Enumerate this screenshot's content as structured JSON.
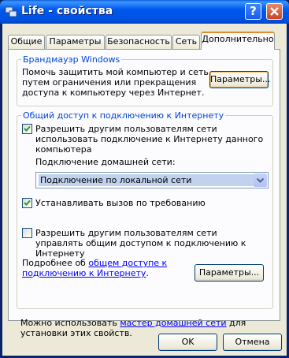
{
  "window": {
    "title": "Life - свойства"
  },
  "tabs": [
    "Общие",
    "Параметры",
    "Безопасность",
    "Сеть",
    "Дополнительно"
  ],
  "firewall": {
    "group_title": "Брандмауэр Windows",
    "description": "Помочь защитить мой компьютер и сеть путем ограничения или прекращения доступа к компьютеру через Интернет.",
    "settings_button": "Параметры..."
  },
  "ics": {
    "group_title": "Общий доступ к подключению к Интернету",
    "allow_connect": {
      "label": "Разрешить другим пользователям сети использовать подключение к Интернету данного компьютера",
      "checked": true
    },
    "home_network_label": "Подключение домашней сети:",
    "home_network_value": "Подключение по локальной сети",
    "dial_on_demand": {
      "label": "Устанавливать вызов по требованию",
      "checked": true
    },
    "allow_control": {
      "label": "Разрешить другим пользователям сети управлять общим доступом к подключению к Интернету",
      "checked": false
    },
    "more_info_prefix": "Подробнее об",
    "more_info_link": "общем доступе к подключению к Интернету",
    "more_info_suffix": ".",
    "settings_button": "Параметры..."
  },
  "wizard": {
    "prefix": "Можно использовать",
    "link": "мастер домашней сети",
    "suffix": "для установки этих свойств."
  },
  "footer": {
    "ok": "OK",
    "cancel": "Отмена"
  }
}
